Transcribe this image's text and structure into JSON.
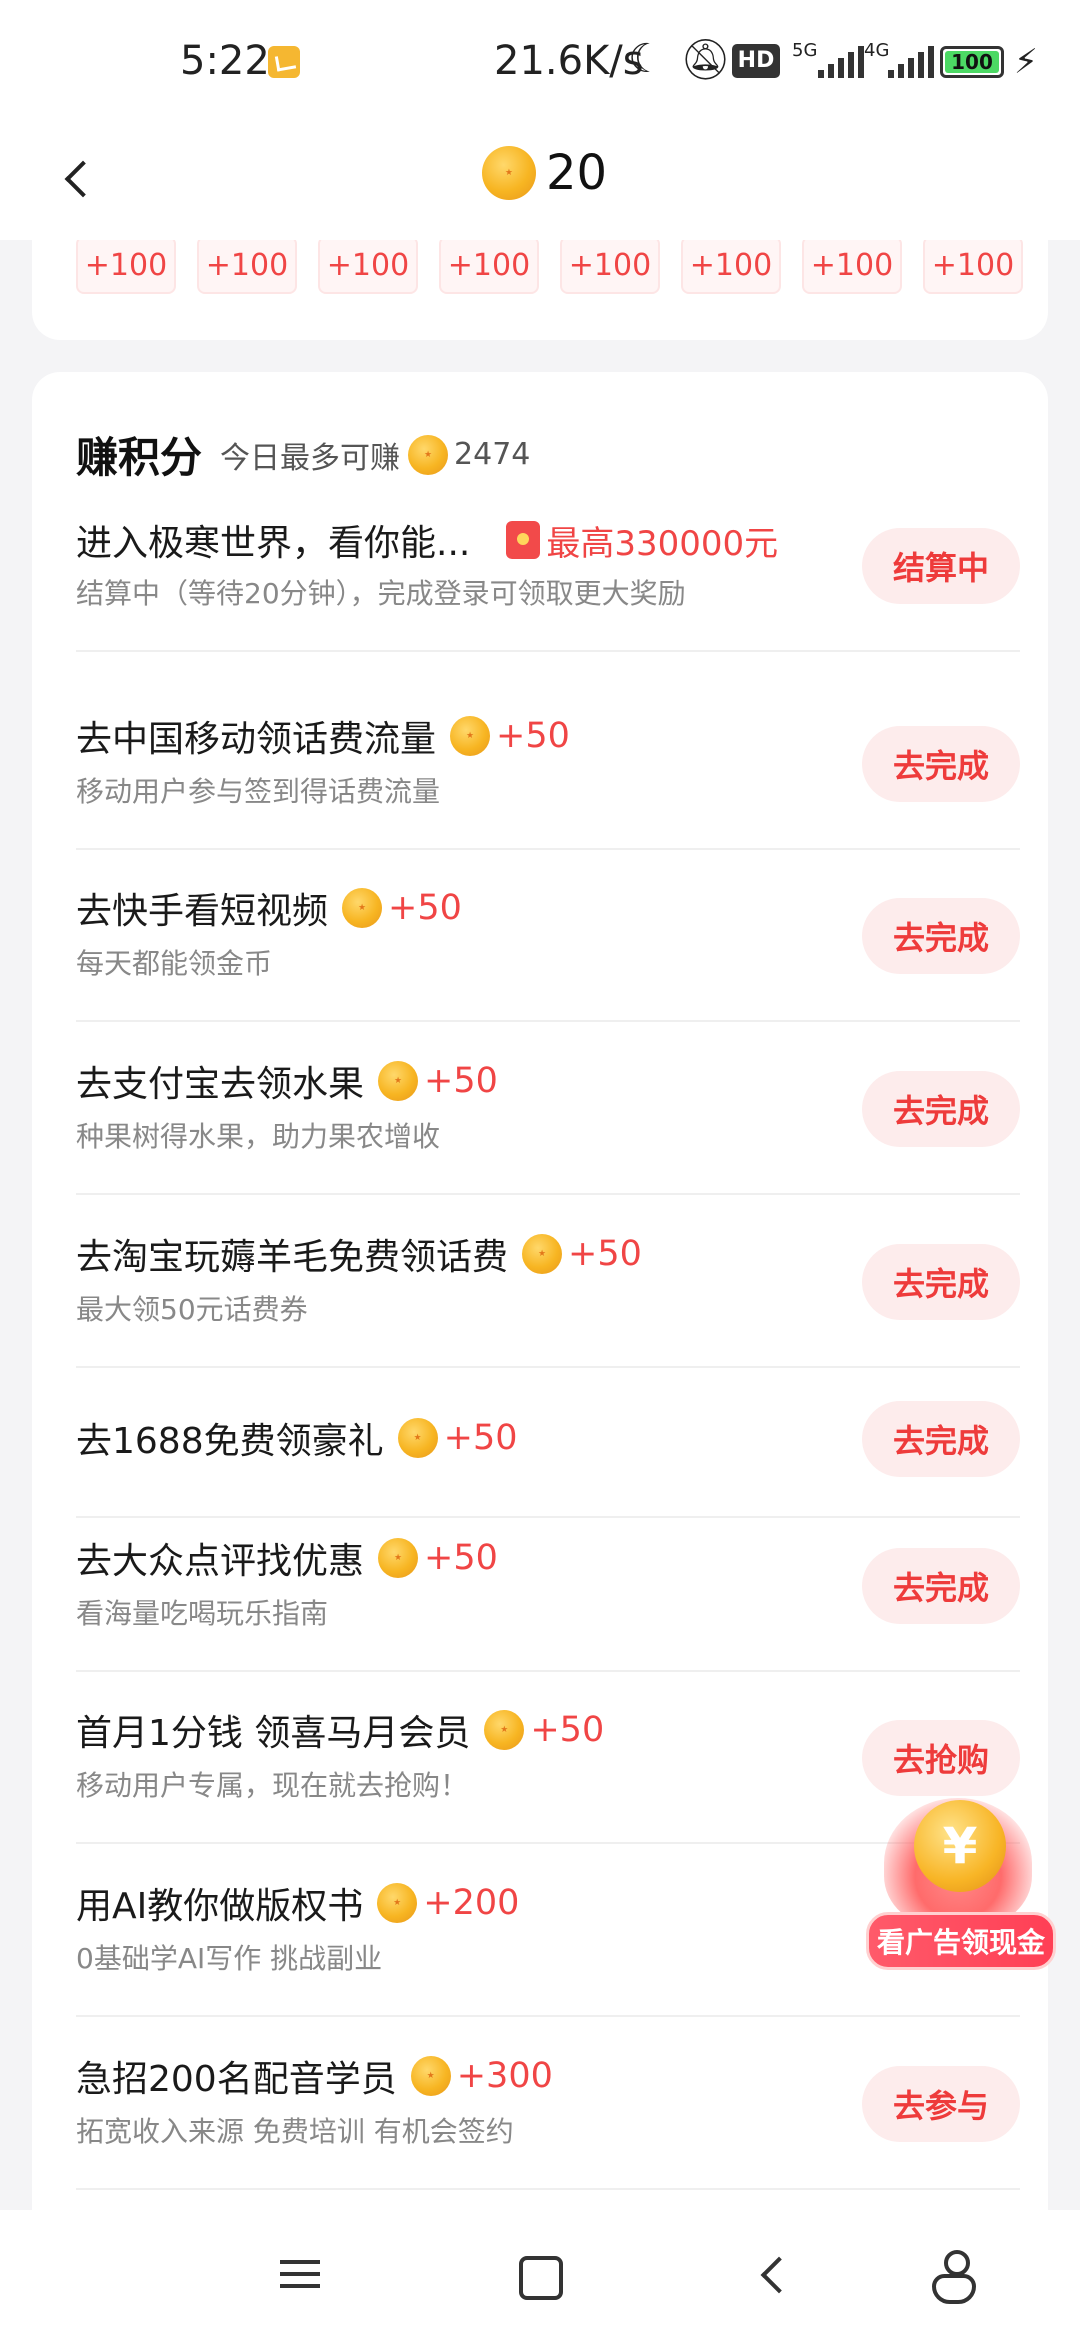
{
  "status_bar": {
    "time": "5:22",
    "network_speed": "21.6K/s",
    "hd_label": "HD",
    "sim1_label": "5G",
    "sim2_label": "4G",
    "battery": "100"
  },
  "header": {
    "coin_count": "20"
  },
  "top_card": {
    "pills": [
      "+100",
      "+100",
      "+100",
      "+100",
      "+100",
      "+100",
      "+100",
      "+100"
    ]
  },
  "earn_section": {
    "title": "赚积分",
    "subtitle": "今日最多可赚",
    "max_points": "2474"
  },
  "tasks": [
    {
      "title": "进入极寒世界，看你能...",
      "max_reward": "最高330000元",
      "desc": "结算中（等待20分钟），完成登录可领取更大奖励",
      "action": "结算中"
    },
    {
      "title": "去中国移动领话费流量",
      "reward": "+50",
      "desc": "移动用户参与签到得话费流量",
      "action": "去完成"
    },
    {
      "title": "去快手看短视频",
      "reward": "+50",
      "desc": "每天都能领金币",
      "action": "去完成"
    },
    {
      "title": "去支付宝去领水果",
      "reward": "+50",
      "desc": "种果树得水果，助力果农增收",
      "action": "去完成"
    },
    {
      "title": "去淘宝玩薅羊毛免费领话费",
      "reward": "+50",
      "desc": "最大领50元话费券",
      "action": "去完成"
    },
    {
      "title": "去1688免费领豪礼",
      "reward": "+50",
      "desc": "",
      "action": "去完成"
    },
    {
      "title": "去大众点评找优惠",
      "reward": "+50",
      "desc": "看海量吃喝玩乐指南",
      "action": "去完成"
    },
    {
      "title": "首月1分钱 领喜马月会员",
      "reward": "+50",
      "desc": "移动用户专属，现在就去抢购！",
      "action": "去抢购"
    },
    {
      "title": "用AI教你做版权书",
      "reward": "+200",
      "desc": "0基础学AI写作 挑战副业",
      "action": ""
    },
    {
      "title": "急招200名配音学员",
      "reward": "+300",
      "desc": "拓宽收入来源 免费培训 有机会签约",
      "action": "去参与"
    }
  ],
  "float_ad": {
    "symbol": "¥",
    "label": "看广告领现金"
  }
}
